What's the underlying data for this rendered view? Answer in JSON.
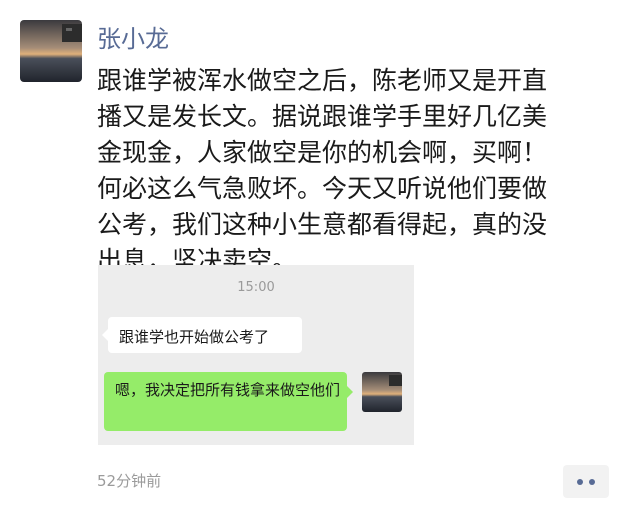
{
  "author": {
    "name": "张小龙",
    "avatar_icon": "sunset-sea-avatar"
  },
  "post": {
    "lines": [
      "跟谁学被浑水做空之后，陈老师又是开直",
      "播又是发长文。据说跟谁学手里好几亿美",
      "金现金，人家做空是你的机会啊，买啊！",
      "何必这么气急败坏。今天又听说他们要做",
      "公考，我们这种小生意都看得起，真的没",
      "出息，坚决卖空。"
    ],
    "time": "52分钟前"
  },
  "screenshot": {
    "time": "15:00",
    "incoming_message": "跟谁学也开始做公考了",
    "outgoing_message": "嗯，我决定把所有钱拿来做空他们"
  },
  "actions": {
    "more_icon": "more-dots-icon"
  },
  "colors": {
    "name": "#586b95",
    "bubble_green": "#95ec69",
    "chat_bg": "#ededed"
  }
}
